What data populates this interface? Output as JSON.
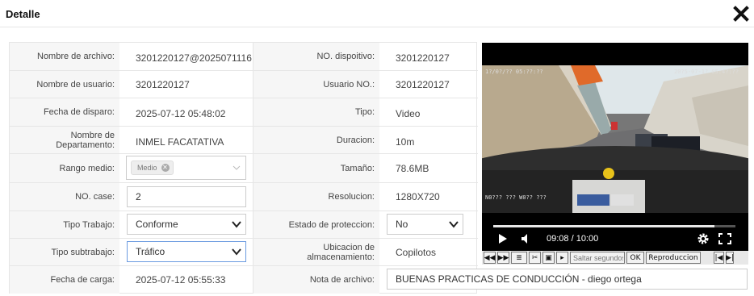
{
  "dialog": {
    "title": "Detalle"
  },
  "rows": [
    {
      "label1": "Nombre de archivo:",
      "value1": "3201220127@2025071116",
      "label2": "NO. dispoitivo:",
      "value2": "3201220127"
    },
    {
      "label1": "Nombre de usuario:",
      "value1": "3201220127",
      "label2": "Usuario NO.:",
      "value2": "3201220127"
    },
    {
      "label1": "Fecha de disparo:",
      "value1": "2025-07-12 05:48:02",
      "label2": "Tipo:",
      "value2": "Video"
    },
    {
      "label1": "Nombre de Departamento:",
      "value1": "INMEL FACATATIVA",
      "label2": "Duracion:",
      "value2": "10m"
    },
    {
      "label1": "Rango medio:",
      "tag": "Medio",
      "label2": "Tamaño:",
      "value2": "78.6MB"
    },
    {
      "label1": "NO. case:",
      "case_value": "2",
      "label2": "Resolucion:",
      "value2": "1280X720"
    },
    {
      "label1": "Tipo Trabajo:",
      "select1": "Conforme",
      "label2": "Estado de proteccion:",
      "select2": "No"
    },
    {
      "label1": "Tipo subtrabajo:",
      "select1": "Tráfico",
      "label2": "Ubicacion de almacenamiento:",
      "value2": "Copilotos"
    },
    {
      "label1": "Fecha de carga:",
      "value1": "2025-07-12 05:55:33",
      "label2": "Nota de archivo:",
      "note": "BUENAS PRACTICAS DE CONDUCCIÓN - diego ortega"
    }
  ],
  "player": {
    "time": "09:08 / 10:00",
    "progress": 0.913,
    "icons": [
      "play-icon",
      "volume-icon",
      "settings-gear-icon",
      "fullscreen-icon"
    ]
  },
  "toolbar": {
    "skip_placeholder": "Saltar segundos",
    "ok_label": "OK",
    "playback_label": "Reproduccion"
  },
  "colors": {
    "label_bg": "#f6f6f6",
    "border": "#e6e6e6",
    "focus": "#6b9be0",
    "video_bg": "#000000"
  }
}
